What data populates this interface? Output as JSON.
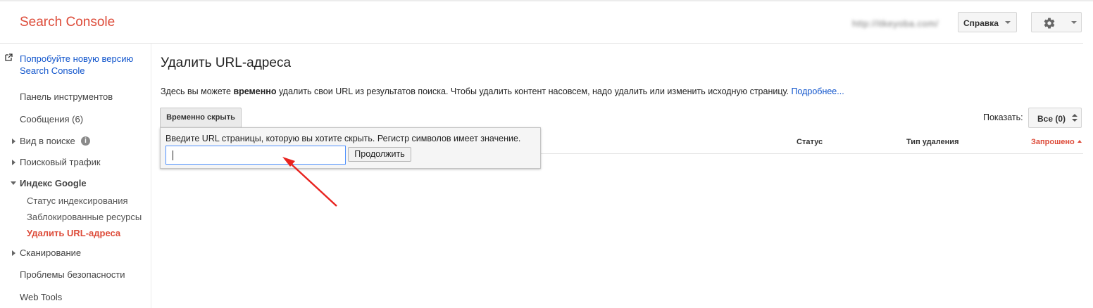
{
  "header": {
    "logo": "Search Console",
    "site_url": "http://itkeyoba.com/",
    "help_label": "Справка",
    "settings_icon": "gear-icon"
  },
  "sidebar": {
    "try_new_line1": "Попробуйте новую версию",
    "try_new_line2": "Search Console",
    "items": [
      {
        "label": "Панель инструментов"
      },
      {
        "label": "Сообщения (6)"
      },
      {
        "label": "Вид в поиске"
      },
      {
        "label": "Поисковый трафик"
      },
      {
        "label": "Индекс Google"
      },
      {
        "label": "Статус индексирования"
      },
      {
        "label": "Заблокированные ресурсы"
      },
      {
        "label": "Удалить URL-адреса"
      },
      {
        "label": "Сканирование"
      },
      {
        "label": "Проблемы безопасности"
      },
      {
        "label": "Web Tools"
      }
    ]
  },
  "main": {
    "title": "Удалить URL-адреса",
    "desc_before": "Здесь вы можете ",
    "desc_bold": "временно",
    "desc_after": " удалить свои URL из результатов поиска. Чтобы удалить контент насовсем, надо удалить или изменить исходную страницу. ",
    "desc_link": "Подробнее...",
    "hide_button": "Временно скрыть",
    "popup_text": "Введите URL страницы, которую вы хотите скрыть. Регистр символов имеет значение.",
    "url_value": "",
    "continue_button": "Продолжить",
    "show_label": "Показать:",
    "show_value": "Все (0)",
    "columns": {
      "status": "Статус",
      "removal_type": "Тип удаления",
      "requested": "Запрошено"
    }
  },
  "colors": {
    "accent_red": "#dd4b39",
    "link_blue": "#1155cc",
    "annotation_arrow": "#e8231f"
  }
}
